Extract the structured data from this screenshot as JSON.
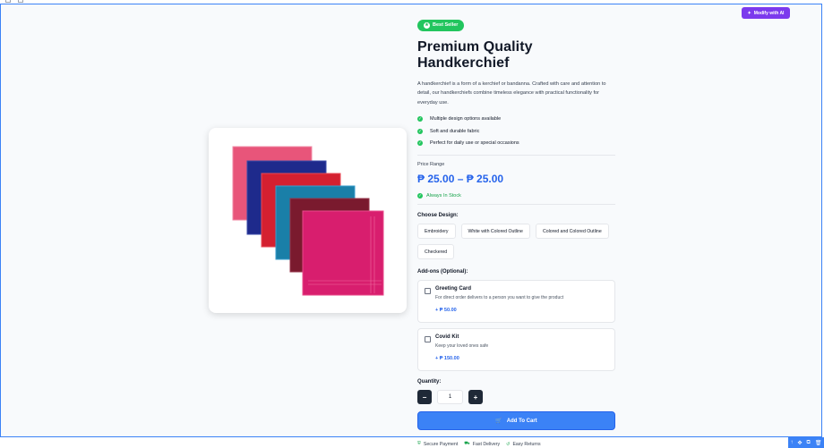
{
  "ai_button": {
    "label": "Modify with AI"
  },
  "product": {
    "badge": "Best Seller",
    "title": "Premium Quality Handkerchief",
    "description": "A handkerchief is a form of a kerchief or bandanna. Crafted with care and attention to detail, our handkerchiefs combine timeless elegance with practical functionality for everyday use.",
    "features": [
      "Multiple design options available",
      "Soft and durable fabric",
      "Perfect for daily use or special occasions"
    ],
    "price_label": "Price Range",
    "price": "₱ 25.00 – ₱ 25.00",
    "stock": "Always In Stock"
  },
  "design": {
    "label": "Choose Design:",
    "options": [
      "Embroidery",
      "White with Colored Outline",
      "Colored and Colored Outline",
      "Checkered"
    ]
  },
  "addons": {
    "label": "Add-ons (Optional):",
    "items": [
      {
        "name": "Greeting Card",
        "desc": "For direct order delivers to a person you want to give the product",
        "price": "+ ₱ 50.00"
      },
      {
        "name": "Covid Kit",
        "desc": "Keep your loved ones safe",
        "price": "+ ₱ 150.00"
      }
    ]
  },
  "quantity": {
    "label": "Quantity:",
    "value": "1",
    "minus": "−",
    "plus": "+"
  },
  "cart": {
    "label": "Add To Cart"
  },
  "trust": {
    "secure": "Secure Payment",
    "delivery": "Fast Delivery",
    "returns": "Easy Returns"
  },
  "colors": {
    "accent": "#3b82f6",
    "badge": "#22c55e",
    "ai": "#7c3aed",
    "handkerchiefs": [
      "#e8557a",
      "#1e2a8c",
      "#d42030",
      "#1a7fa8",
      "#7a1a2e",
      "#d81e6e"
    ]
  }
}
